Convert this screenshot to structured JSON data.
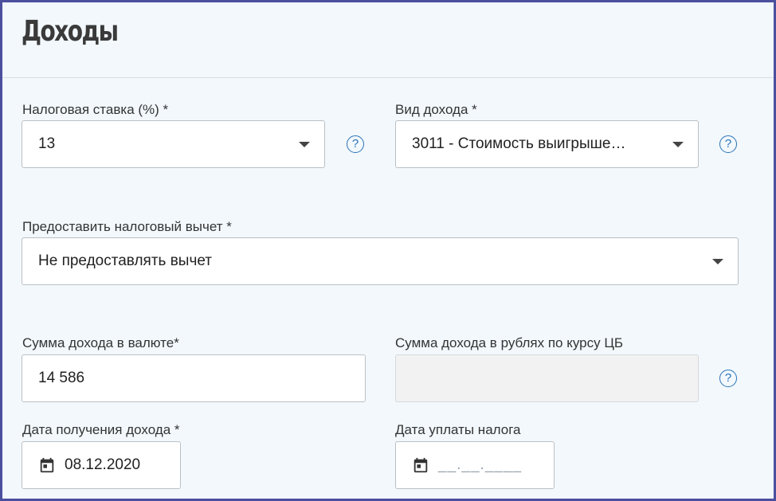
{
  "header": {
    "title": "Доходы"
  },
  "tax_rate": {
    "label": "Налоговая ставка (%) *",
    "value": "13",
    "help_icon": "question-circle-icon",
    "help_glyph": "?"
  },
  "income_type": {
    "label": "Вид дохода *",
    "value": "3011 - Стоимость выигрыше…",
    "help_glyph": "?"
  },
  "tax_deduction": {
    "label": "Предоставить налоговый вычет *",
    "value": "Не предоставлять вычет"
  },
  "income_currency": {
    "label": "Сумма дохода в валюте*",
    "value": "14 586"
  },
  "income_rub": {
    "label": "Сумма дохода в рублях по курсу ЦБ",
    "value": "",
    "help_glyph": "?"
  },
  "income_date": {
    "label": "Дата получения дохода *",
    "value": "08.12.2020",
    "icon": "calendar-icon"
  },
  "tax_payment_date": {
    "label": "Дата уплаты налога",
    "placeholder": "__.__.____",
    "icon": "calendar-icon"
  },
  "colors": {
    "frame_border": "#4a4f9e",
    "background": "#f2f8fc",
    "help_accent": "#2a72b8"
  }
}
